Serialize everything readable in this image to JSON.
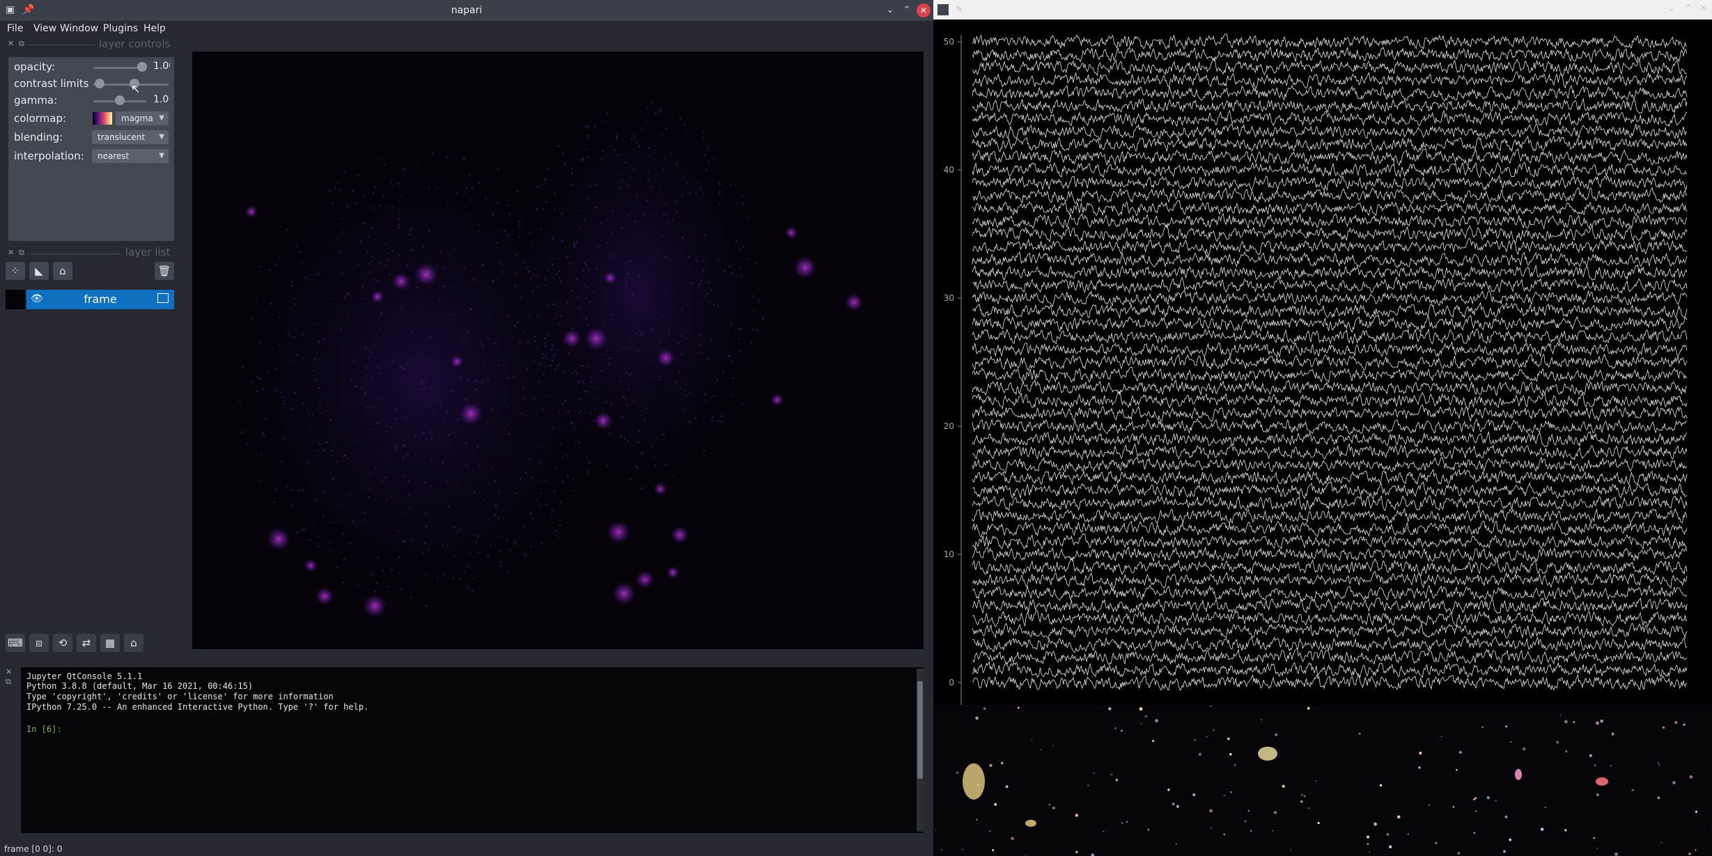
{
  "napari": {
    "title": "napari",
    "menu": [
      "File",
      "View",
      "Window",
      "Plugins",
      "Help"
    ],
    "layer_controls": {
      "title": "layer controls",
      "opacity": {
        "label": "opacity:",
        "value": "1.00",
        "level": 1.0
      },
      "contrast_limits": {
        "label": "contrast limits",
        "low": 0.08,
        "high": 0.55
      },
      "gamma": {
        "label": "gamma:",
        "value": "1.0",
        "level": 0.5
      },
      "colormap": {
        "label": "colormap:",
        "value": "magma"
      },
      "blending": {
        "label": "blending:",
        "value": "translucent"
      },
      "interpolation": {
        "label": "interpolation:",
        "value": "nearest"
      }
    },
    "layer_list": {
      "title": "layer list",
      "layers": [
        {
          "name": "frame",
          "visible": true
        }
      ]
    },
    "console": {
      "lines": [
        "Jupyter QtConsole 5.1.1",
        "Python 3.8.8 (default, Mar 16 2021, 00:46:15)",
        "Type 'copyright', 'credits' or 'license' for more information",
        "IPython 7.25.0 -- An enhanced Interactive Python. Type '?' for help."
      ],
      "prompt": "In [6]:"
    },
    "status": "frame [0 0]: 0"
  },
  "plot": {
    "chart_data": {
      "type": "line",
      "title": "",
      "xlabel": "",
      "ylabel": "",
      "xlim": [
        0,
        2000
      ],
      "ylim": [
        0,
        50
      ],
      "xticks": [
        0,
        200,
        400,
        600,
        800,
        1000,
        1200,
        1400,
        1600,
        1800,
        2000
      ],
      "yticks": [
        0,
        10,
        20,
        30,
        40,
        50
      ],
      "series_count": 51,
      "series_offset_step": 1,
      "line_color": "#ffffff",
      "background": "#000000",
      "grid": false,
      "legend": "none"
    }
  },
  "colors": {
    "accent": "#0f6fc0",
    "panel": "#414851",
    "window_bg": "#262930",
    "close_button": "#d9454a"
  },
  "icons": [
    "menu-app-icon",
    "pin-icon",
    "minimize-icon",
    "maximize-icon",
    "close-icon",
    "add-points-icon",
    "add-shapes-icon",
    "add-labels-icon",
    "delete-layer-icon",
    "eye-icon",
    "image-layer-icon",
    "console-icon",
    "ndisplay-icon",
    "roll-icon",
    "transpose-icon",
    "grid-icon",
    "home-icon"
  ]
}
